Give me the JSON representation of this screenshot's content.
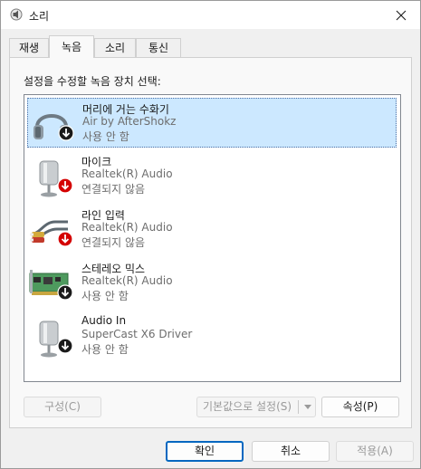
{
  "window": {
    "title": "소리"
  },
  "tabs": [
    {
      "label": "재생",
      "active": false
    },
    {
      "label": "녹음",
      "active": true
    },
    {
      "label": "소리",
      "active": false
    },
    {
      "label": "통신",
      "active": false
    }
  ],
  "instruction": "설정을 수정할 녹음 장치 선택:",
  "devices": [
    {
      "name": "머리에 거는 수화기",
      "driver": "Air by AfterShokz",
      "status": "사용 안 함",
      "icon": "headset-icon",
      "badge": "down-arrow-badge",
      "selected": true
    },
    {
      "name": "마이크",
      "driver": "Realtek(R) Audio",
      "status": "연결되지 않음",
      "icon": "microphone-icon",
      "badge": "red-down-arrow-badge",
      "selected": false
    },
    {
      "name": "라인 입력",
      "driver": "Realtek(R) Audio",
      "status": "연결되지 않음",
      "icon": "line-in-cable-icon",
      "badge": "red-down-arrow-badge",
      "selected": false
    },
    {
      "name": "스테레오 믹스",
      "driver": "Realtek(R) Audio",
      "status": "사용 안 함",
      "icon": "sound-card-icon",
      "badge": "down-arrow-badge",
      "selected": false
    },
    {
      "name": "Audio In",
      "driver": "SuperCast X6 Driver",
      "status": "사용 안 함",
      "icon": "microphone-icon",
      "badge": "down-arrow-badge",
      "selected": false
    }
  ],
  "buttons": {
    "configure": "구성(C)",
    "set_default": "기본값으로 설정(S)",
    "properties": "속성(P)",
    "ok": "확인",
    "cancel": "취소",
    "apply": "적용(A)"
  },
  "colors": {
    "selection_bg": "#cce8ff",
    "accent": "#0067c0",
    "red_badge": "#d40000"
  }
}
